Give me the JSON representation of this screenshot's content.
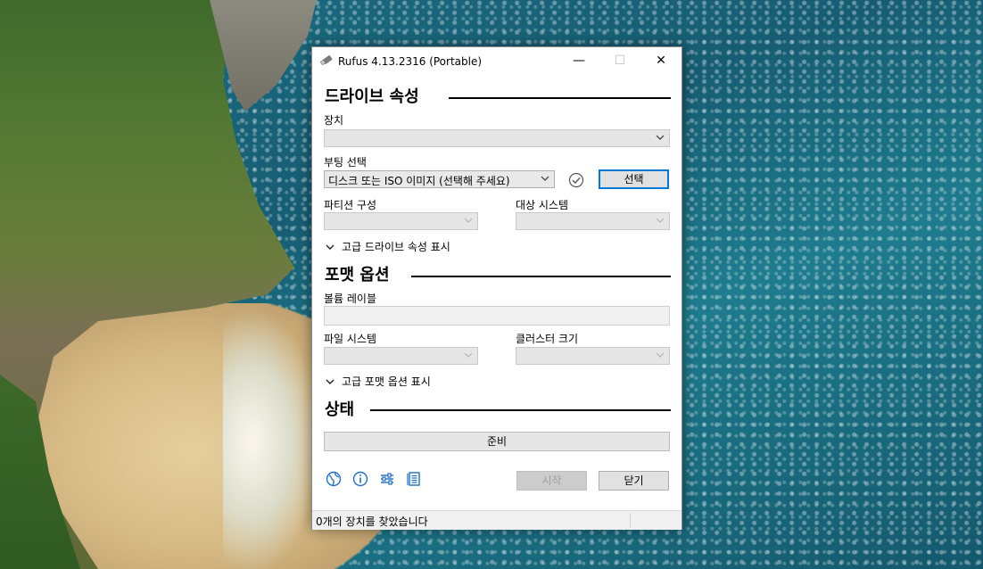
{
  "window": {
    "title": "Rufus 4.13.2316 (Portable)",
    "minimize_glyph": "—",
    "maximize_glyph": "☐",
    "close_glyph": "✕"
  },
  "drive_section": {
    "heading": "드라이브 속성",
    "device_label": "장치",
    "device_value": "",
    "boot_label": "부팅 선택",
    "boot_value": "디스크 또는 ISO 이미지 (선택해 주세요)",
    "select_button": "선택",
    "partition_label": "파티션 구성",
    "partition_value": "",
    "target_label": "대상 시스템",
    "target_value": "",
    "advanced_toggle": "고급 드라이브 속성 표시"
  },
  "format_section": {
    "heading": "포맷 옵션",
    "volume_label": "볼륨 레이블",
    "volume_value": "",
    "filesystem_label": "파일 시스템",
    "filesystem_value": "",
    "cluster_label": "클러스터 크기",
    "cluster_value": "",
    "advanced_toggle": "고급 포맷 옵션 표시"
  },
  "status_section": {
    "heading": "상태",
    "progress_text": "준비",
    "progress_value": 0
  },
  "footer": {
    "icons": [
      "globe-icon",
      "info-icon",
      "settings-sliders-icon",
      "log-icon"
    ],
    "start_button": "시작",
    "close_button": "닫기"
  },
  "statusbar": {
    "text": "0개의 장치를 찾았습니다"
  },
  "colors": {
    "accent": "#0078d7",
    "icon_blue": "#1e6fc8",
    "disabled_bg": "#cccccc"
  }
}
